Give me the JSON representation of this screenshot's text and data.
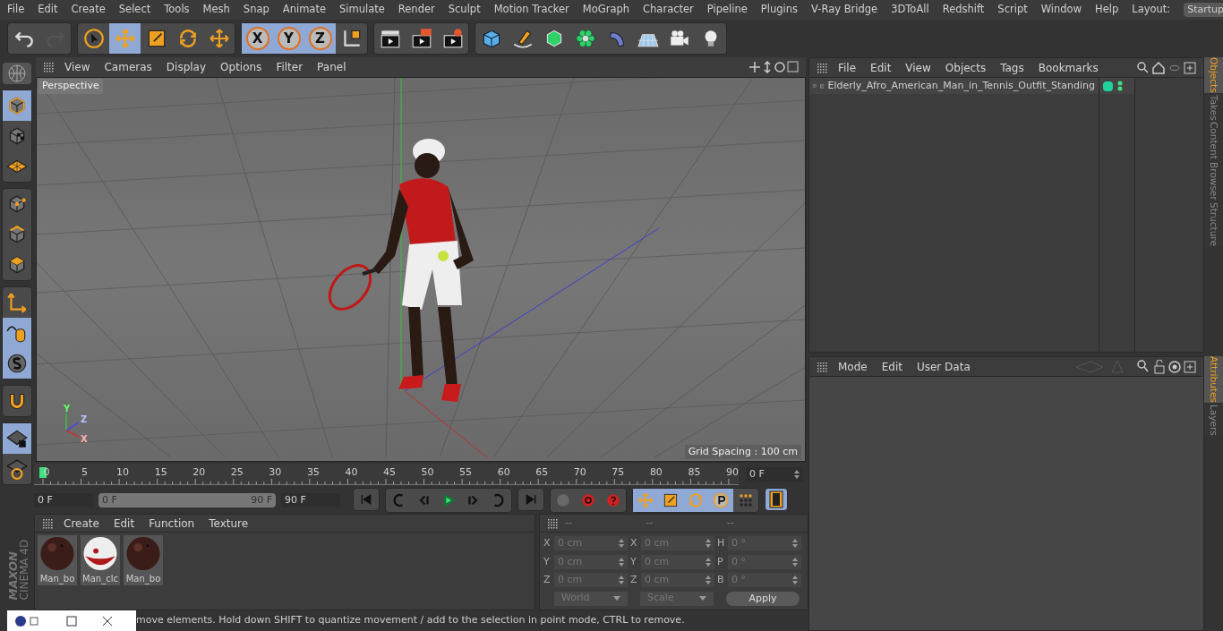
{
  "menu_bar": {
    "items": [
      "File",
      "Edit",
      "Create",
      "Select",
      "Tools",
      "Mesh",
      "Snap",
      "Animate",
      "Simulate",
      "Render",
      "Sculpt",
      "Motion Tracker",
      "MoGraph",
      "Character",
      "Pipeline",
      "Plugins",
      "V-Ray Bridge",
      "3DToAll",
      "Redshift",
      "Script",
      "Window",
      "Help"
    ],
    "layout_label": "Layout:",
    "layout_value": "Startup"
  },
  "toolbar": {
    "groups": [
      [
        {
          "selected": false
        },
        {
          "selected": false,
          "disabled": true
        }
      ],
      [
        {
          "selected": false
        },
        {
          "selected": true
        },
        {
          "selected": false
        },
        {
          "selected": false
        },
        {
          "selected": false
        }
      ],
      [
        {
          "selected": true,
          "label": "X"
        },
        {
          "selected": true,
          "label": "Y"
        },
        {
          "selected": true,
          "label": "Z"
        },
        {
          "selected": false
        }
      ],
      [
        {
          "selected": false
        },
        {
          "selected": false
        },
        {
          "selected": false
        }
      ],
      [
        {
          "selected": false
        },
        {
          "selected": false
        },
        {
          "selected": false
        },
        {
          "selected": false
        },
        {
          "selected": false
        },
        {
          "selected": false
        },
        {
          "selected": false
        },
        {
          "selected": false
        }
      ]
    ]
  },
  "left_tools": {
    "groups": [
      [
        {
          "selected": true
        },
        {
          "selected": false
        },
        {
          "selected": false
        }
      ],
      [
        {
          "selected": false
        },
        {
          "selected": false
        },
        {
          "selected": false
        }
      ],
      [
        {
          "selected": false
        },
        {
          "selected": true
        },
        {
          "selected": true
        }
      ],
      [
        {
          "selected": false
        }
      ],
      [
        {
          "selected": true
        },
        {
          "selected": false
        }
      ]
    ]
  },
  "viewport": {
    "menu": [
      "View",
      "Cameras",
      "Display",
      "Options",
      "Filter",
      "Panel"
    ],
    "camera_label": "Perspective",
    "grid_spacing": "Grid Spacing : 100 cm",
    "axis_labels": [
      "Y",
      "Z",
      "X"
    ]
  },
  "timeline": {
    "ruler_labels": [
      "0",
      "5",
      "10",
      "15",
      "20",
      "25",
      "30",
      "35",
      "40",
      "45",
      "50",
      "55",
      "60",
      "65",
      "70",
      "75",
      "80",
      "85",
      "90"
    ],
    "playhead": {
      "level": 0
    },
    "current_frame": "0 F",
    "start_field": "0 F",
    "range_slider": {
      "level": 1
    },
    "range_start": "0 F",
    "range_end": "90 F",
    "end_field": "90 F"
  },
  "playback": {
    "key_tools": [
      {
        "selected": true
      },
      {
        "selected": true
      },
      {
        "selected": true
      },
      {
        "selected": true
      },
      {
        "selected": false
      }
    ],
    "timeline_button": {
      "selected": true
    }
  },
  "materials": {
    "menu": [
      "Create",
      "Edit",
      "Function",
      "Texture"
    ],
    "items": [
      {
        "name": "Man_bo",
        "kind": "dark"
      },
      {
        "name": "Man_clc",
        "kind": "cloth"
      },
      {
        "name": "Man_bo",
        "kind": "dark"
      }
    ]
  },
  "coordinates": {
    "headers": [
      "--",
      "--",
      "--"
    ],
    "rows": [
      {
        "labels": [
          "X",
          "X",
          "H"
        ],
        "values": [
          "0 cm",
          "0 cm",
          "0 °"
        ]
      },
      {
        "labels": [
          "Y",
          "Y",
          "P"
        ],
        "values": [
          "0 cm",
          "0 cm",
          "0 °"
        ]
      },
      {
        "labels": [
          "Z",
          "Z",
          "B"
        ],
        "values": [
          "0 cm",
          "0 cm",
          "0 °"
        ]
      }
    ],
    "space": "World",
    "mode": "Scale",
    "apply": "Apply"
  },
  "object_manager": {
    "menu": [
      "File",
      "Edit",
      "View",
      "Objects",
      "Tags",
      "Bookmarks"
    ],
    "objects": [
      {
        "name": "Elderly_Afro_American_Man_in_Tennis_Outfit_Standing",
        "color": "#1fd39a"
      }
    ]
  },
  "attribute_manager": {
    "menu": [
      "Mode",
      "Edit",
      "User Data"
    ]
  },
  "side_tabs_top": [
    {
      "label": "Objects",
      "selected": true
    },
    {
      "label": "Takes",
      "selected": false
    },
    {
      "label": "Content Browser",
      "selected": false
    },
    {
      "label": "Structure",
      "selected": false
    }
  ],
  "side_tabs_bottom": [
    {
      "label": "Attributes",
      "selected": true
    },
    {
      "label": "Layers",
      "selected": false
    }
  ],
  "logo": {
    "brand": "MAXON",
    "product": "CINEMA 4D"
  },
  "status_bar": {
    "text": "move elements. Hold down SHIFT to quantize movement / add to the selection in point mode, CTRL to remove."
  }
}
